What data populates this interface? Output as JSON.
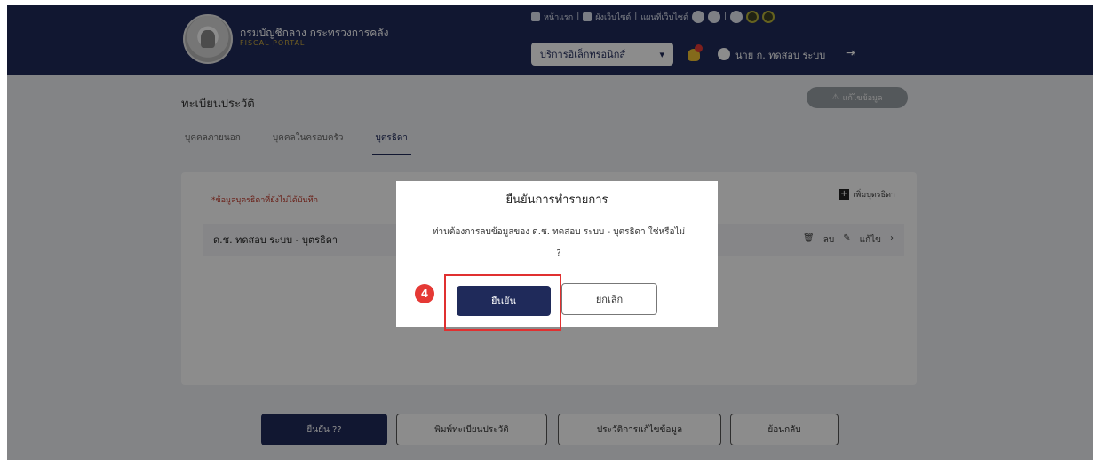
{
  "header": {
    "agency_name": "กรมบัญชีกลาง กระทรวงการคลัง",
    "agency_sub": "FISCAL PORTAL",
    "top_links": [
      "หน้าแรก",
      "ผังเว็บไซต์",
      "แผนที่เว็บไซต์"
    ],
    "service_select": "บริการอิเล็กทรอนิกส์",
    "user_name": "นาย ก. ทดสอบ ระบบ"
  },
  "page": {
    "title": "ทะเบียนประวัติ",
    "status_pill": "แก้ไขข้อมูล",
    "tabs": [
      "บุคคลภายนอก",
      "บุคคลในครอบครัว",
      "บุตรธิดา"
    ],
    "card_note": "*ข้อมูลบุตรธิดาที่ยังไม่ได้บันทึก",
    "add_label": "เพิ่มบุตรธิดา",
    "row_text": "ด.ช. ทดสอบ ระบบ - บุตรธิดา",
    "row_action_delete": "ลบ",
    "row_action_edit": "แก้ไข"
  },
  "bottom_buttons": {
    "save": "ยืนยัน ??",
    "print": "พิมพ์ทะเบียนประวัติ",
    "history": "ประวัติการแก้ไขข้อมูล",
    "back": "ย้อนกลับ"
  },
  "modal": {
    "title": "ยืนยันการทำรายการ",
    "message": "ท่านต้องการลบข้อมูลของ ด.ช. ทดสอบ ระบบ - บุตรธิดา ใช่หรือไม่",
    "message_tail": "?",
    "confirm": "ยืนยัน",
    "cancel": "ยกเลิก"
  },
  "annotation": {
    "step": "4"
  },
  "colors": {
    "navy": "#1f2a5a",
    "highlight": "#e03030"
  }
}
